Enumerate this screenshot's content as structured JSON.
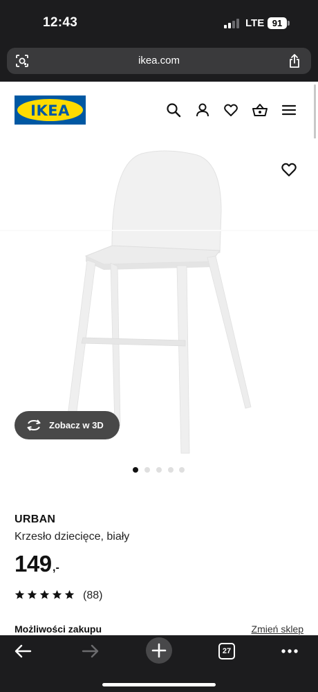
{
  "status_bar": {
    "time": "12:43",
    "network": "LTE",
    "battery": "91"
  },
  "browser": {
    "url": "ikea.com",
    "tabs_count": "27",
    "icons": [
      "lens-icon",
      "share-icon",
      "back-arrow-icon",
      "forward-arrow-icon",
      "new-tab-plus-icon",
      "more-dots-icon"
    ]
  },
  "header": {
    "logo_text": "IKEA",
    "icons": [
      "search-icon",
      "account-icon",
      "heart-icon",
      "basket-icon",
      "menu-icon"
    ]
  },
  "product": {
    "name": "URBAN",
    "description": "Krzesło dziecięce, biały",
    "price": "149",
    "price_suffix": ",-",
    "rating": 5,
    "reviews": "(88)",
    "view_3d_label": "Zobacz w 3D",
    "image_count": 5,
    "active_image": 1
  },
  "purchase": {
    "options_title": "Możliwości zakupu",
    "change_store_label": "Zmień sklep"
  },
  "colors": {
    "ikea_blue": "#0058a3",
    "ikea_yellow": "#ffdb00",
    "chrome_dark": "#1c1c1e"
  }
}
